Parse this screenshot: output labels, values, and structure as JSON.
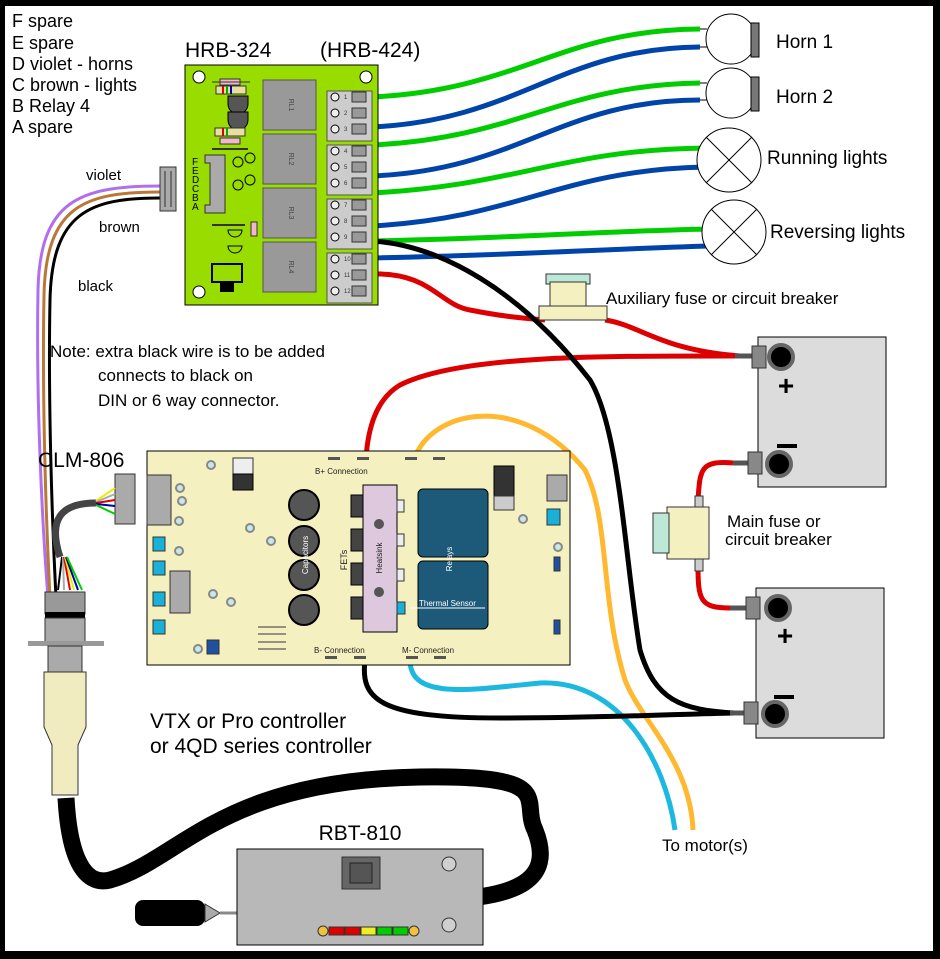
{
  "legend": {
    "lines": [
      "F spare",
      "E spare",
      "D violet - horns",
      "C brown - lights",
      "B Relay 4",
      "A spare"
    ]
  },
  "relay_board": {
    "title": "HRB-324",
    "alt_title": "(HRB-424)",
    "relays": [
      "RL1",
      "RL2",
      "RL3",
      "RL4"
    ],
    "connector_pins": [
      "F",
      "E",
      "D",
      "C",
      "B",
      "A"
    ],
    "terminals": [
      "1",
      "2",
      "3",
      "4",
      "5",
      "6",
      "7",
      "8",
      "9",
      "10",
      "11",
      "12"
    ]
  },
  "wire_labels": {
    "violet": "violet",
    "brown": "brown",
    "black": "black"
  },
  "note": {
    "line1": "Note: extra black wire is to be added",
    "line2": "connects to black on",
    "line3": "DIN or 6 way connector."
  },
  "loads": {
    "horn1": "Horn 1",
    "horn2": "Horn 2",
    "running": "Running lights",
    "reversing": "Reversing lights"
  },
  "fuses": {
    "aux": "Auxiliary fuse or circuit breaker",
    "main_line1": "Main fuse or",
    "main_line2": "circuit breaker"
  },
  "batteries": {
    "plus": "+",
    "minus": "−"
  },
  "clm": {
    "title": "CLM-806"
  },
  "controller": {
    "b_plus": "B+ Connection",
    "b_minus": "B- Connection",
    "m_minus": "M- Connection",
    "fets": "FETs",
    "heatsink": "Heatsink",
    "capacitors": "Capacitors",
    "relays": "Relays",
    "thermal": "Thermal Sensor",
    "caption_line1": "VTX or Pro controller",
    "caption_line2": "or 4QD series controller"
  },
  "motor": {
    "label": "To motor(s)"
  },
  "remote": {
    "title": "RBT-810",
    "battery_gauge_segments": [
      "red",
      "red",
      "yellow",
      "green",
      "green"
    ]
  },
  "colors": {
    "board_green": "#99dd00",
    "controller_bg": "#f4f0c0",
    "wire_green": "#00cc00",
    "wire_blue": "#0044aa",
    "wire_red": "#dd0000",
    "wire_black": "#000000",
    "wire_violet": "#b070ee",
    "wire_brown": "#b87838",
    "wire_orange": "#ffb830",
    "wire_cyan": "#1cb8e0",
    "relay_dark": "#1d5a7a",
    "heatsink_pink": "#ddc8dd",
    "battery_gray": "#dcdcdc",
    "remote_gray": "#b8b8b8"
  }
}
